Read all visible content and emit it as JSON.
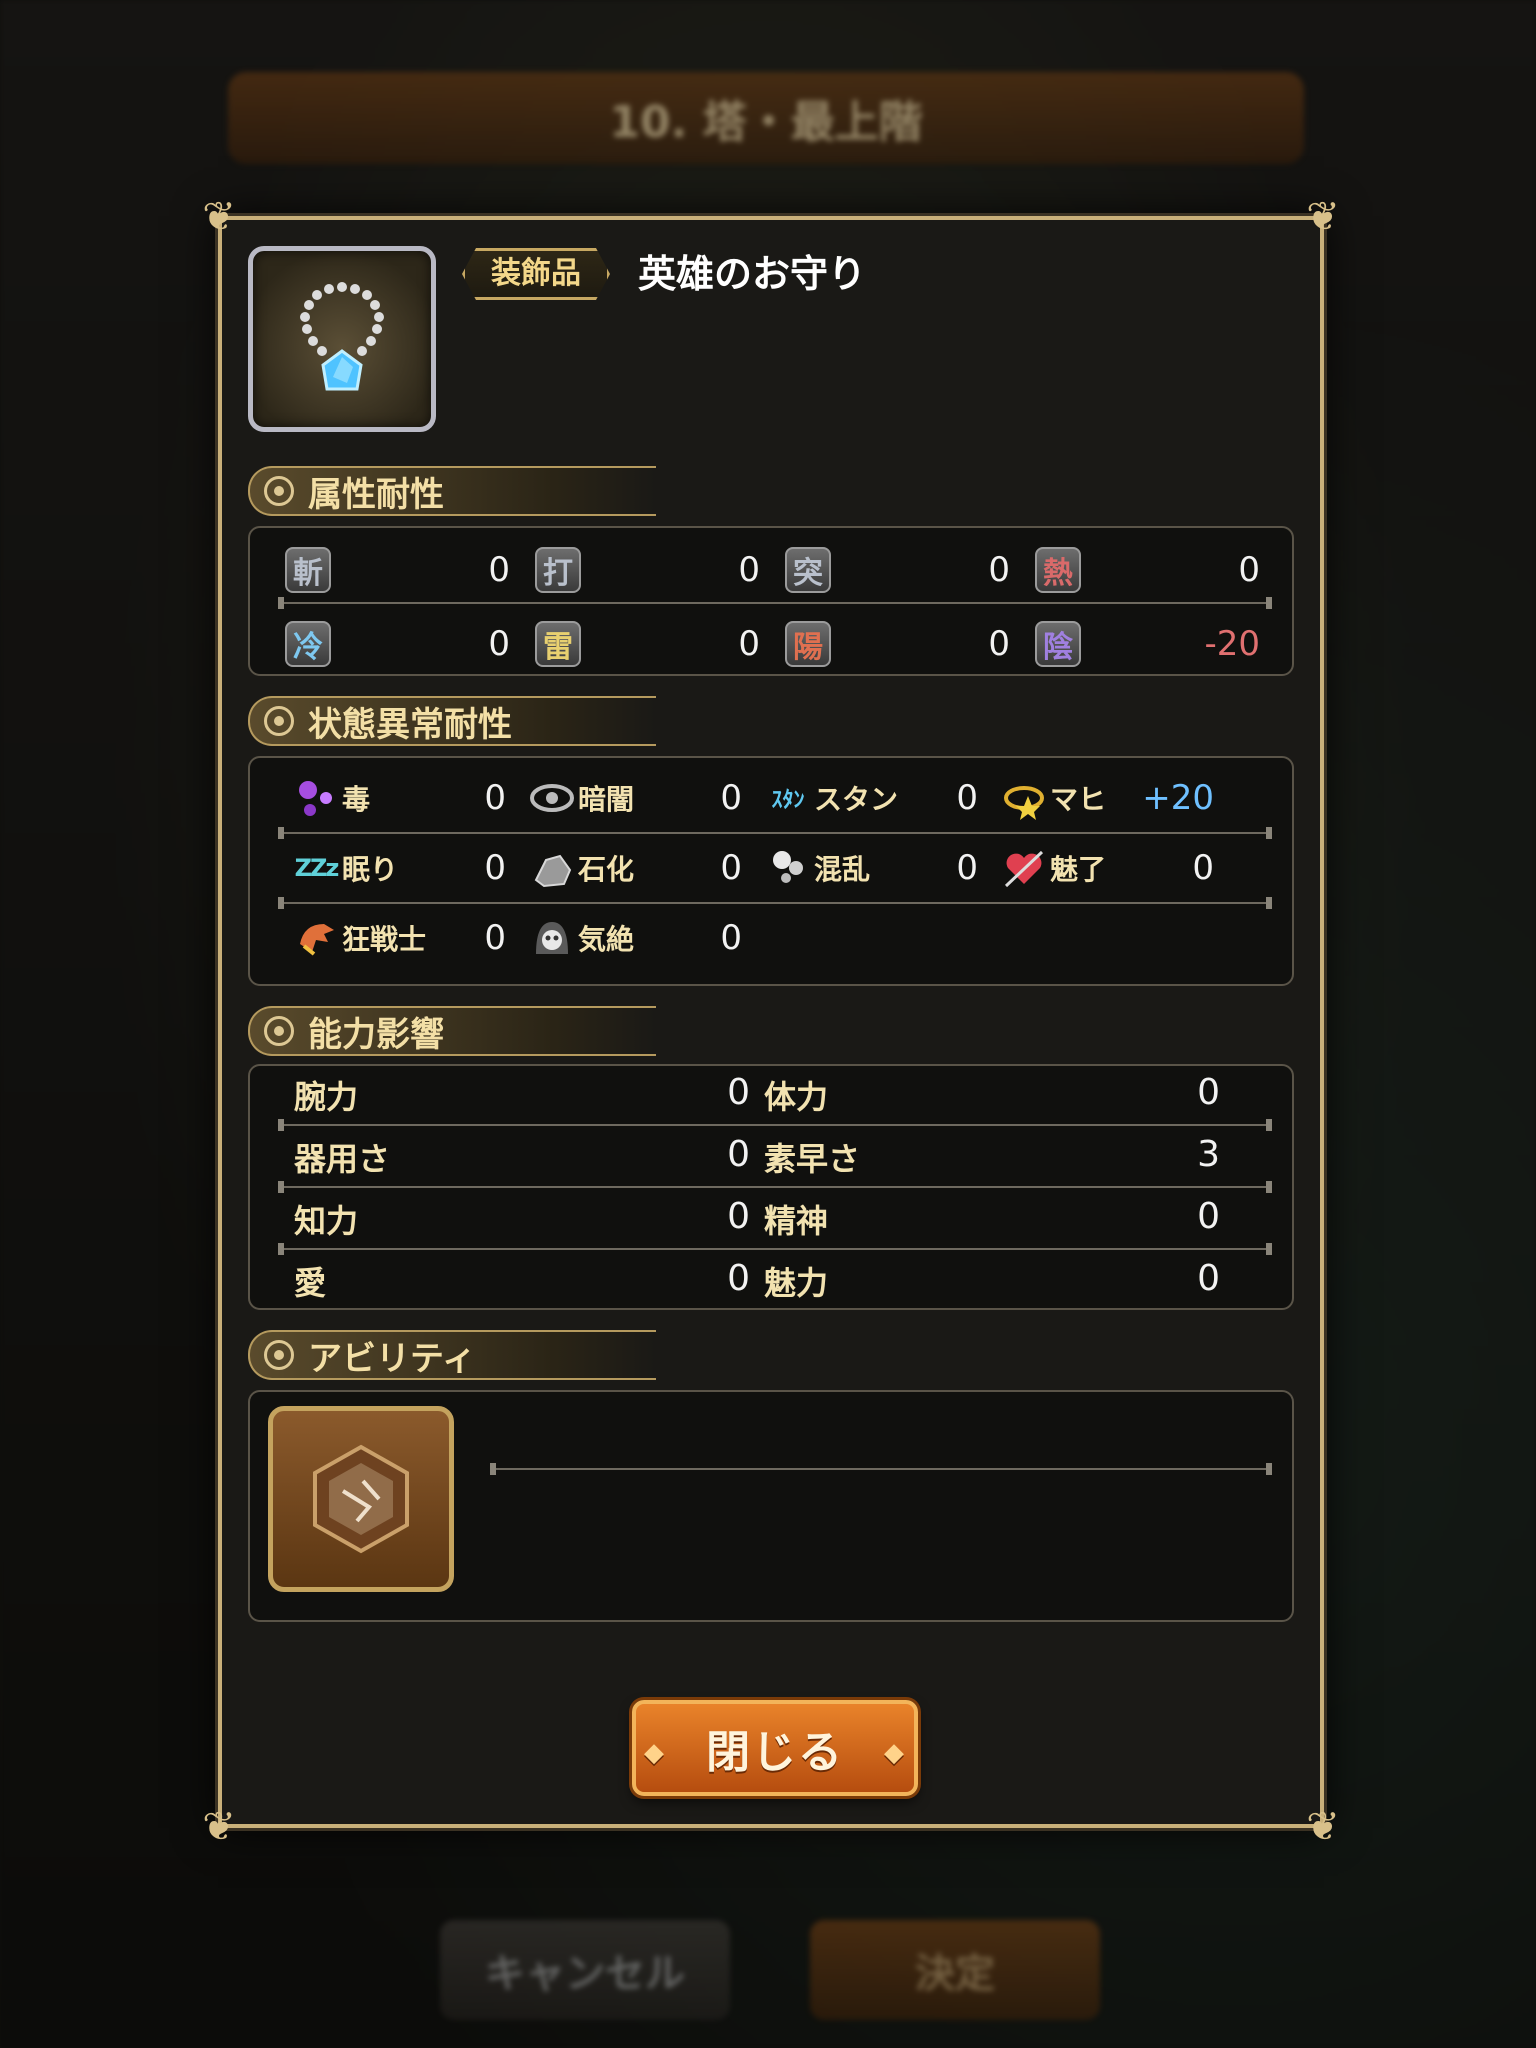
{
  "background": {
    "header_title": "10. 塔・最上階",
    "cancel_label": "キャンセル",
    "confirm_label": "決定"
  },
  "item": {
    "category": "装飾品",
    "name": "英雄のお守り",
    "icon": "necklace-icon"
  },
  "sections": {
    "element_resist": "属性耐性",
    "status_resist": "状態異常耐性",
    "stat_effect": "能力影響",
    "ability": "アビリティ"
  },
  "elements": [
    {
      "glyph": "斬",
      "value": "0",
      "color": "#b9c0cc"
    },
    {
      "glyph": "打",
      "value": "0",
      "color": "#b9c0cc"
    },
    {
      "glyph": "突",
      "value": "0",
      "color": "#b9c0cc"
    },
    {
      "glyph": "熱",
      "value": "0",
      "color": "#d96a6a"
    },
    {
      "glyph": "冷",
      "value": "0",
      "color": "#7ec8f0"
    },
    {
      "glyph": "雷",
      "value": "0",
      "color": "#e8d070"
    },
    {
      "glyph": "陽",
      "value": "0",
      "color": "#e07050"
    },
    {
      "glyph": "陰",
      "value": "-20",
      "color": "#a080e0"
    }
  ],
  "status": [
    {
      "label": "毒",
      "value": "0",
      "icon": "poison-icon"
    },
    {
      "label": "暗闇",
      "value": "0",
      "icon": "blind-eye-icon"
    },
    {
      "label": "スタン",
      "value": "0",
      "icon": "stun-icon",
      "icon_text": "ｽﾀﾝ"
    },
    {
      "label": "マヒ",
      "value": "+20",
      "icon": "paralysis-icon"
    },
    {
      "label": "眠り",
      "value": "0",
      "icon": "sleep-icon",
      "icon_text": "ZZz"
    },
    {
      "label": "石化",
      "value": "0",
      "icon": "petrify-icon"
    },
    {
      "label": "混乱",
      "value": "0",
      "icon": "confuse-icon"
    },
    {
      "label": "魅了",
      "value": "0",
      "icon": "charm-heart-icon"
    },
    {
      "label": "狂戦士",
      "value": "0",
      "icon": "berserk-icon"
    },
    {
      "label": "気絶",
      "value": "0",
      "icon": "faint-skull-icon"
    }
  ],
  "stats": [
    {
      "label": "腕力",
      "value": "0"
    },
    {
      "label": "体力",
      "value": "0"
    },
    {
      "label": "器用さ",
      "value": "0"
    },
    {
      "label": "素早さ",
      "value": "3"
    },
    {
      "label": "知力",
      "value": "0"
    },
    {
      "label": "精神",
      "value": "0"
    },
    {
      "label": "愛",
      "value": "0"
    },
    {
      "label": "魅力",
      "value": "0"
    }
  ],
  "close_button": "閉じる"
}
